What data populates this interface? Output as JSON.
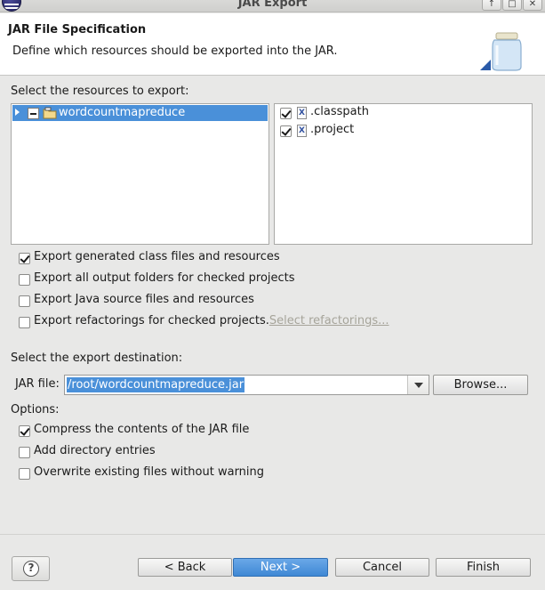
{
  "window": {
    "title": "JAR Export",
    "controls": [
      "up-icon",
      "maximize-icon",
      "close-icon"
    ]
  },
  "header": {
    "title": "JAR File Specification",
    "description": "Define which resources should be exported into the JAR."
  },
  "resources": {
    "label": "Select the resources to export:",
    "tree": [
      {
        "label": "wordcountmapreduce",
        "state": "partial",
        "expanded": false,
        "selected": true
      }
    ],
    "files": [
      {
        "label": ".classpath",
        "checked": true
      },
      {
        "label": ".project",
        "checked": true
      }
    ]
  },
  "export_options": [
    {
      "label": "Export generated class files and resources",
      "checked": true
    },
    {
      "label": "Export all output folders for checked projects",
      "checked": false
    },
    {
      "label": "Export Java source files and resources",
      "checked": false
    },
    {
      "label": "Export refactorings for checked projects.",
      "checked": false,
      "link": "Select refactorings..."
    }
  ],
  "destination": {
    "label": "Select the export destination:",
    "jar_label": "JAR file:",
    "jar_value": "/root/wordcountmapreduce.jar",
    "browse_label": "Browse..."
  },
  "options": {
    "label": "Options:",
    "items": [
      {
        "label": "Compress the contents of the JAR file",
        "checked": true
      },
      {
        "label": "Add directory entries",
        "checked": false
      },
      {
        "label": "Overwrite existing files without warning",
        "checked": false
      }
    ]
  },
  "footer": {
    "help_icon": "help-icon",
    "help_glyph": "?",
    "back_label": "< Back",
    "next_label": "Next >",
    "cancel_label": "Cancel",
    "finish_label": "Finish"
  },
  "colors": {
    "selection": "#4a90d9",
    "link_disabled": "#a6a49a"
  }
}
